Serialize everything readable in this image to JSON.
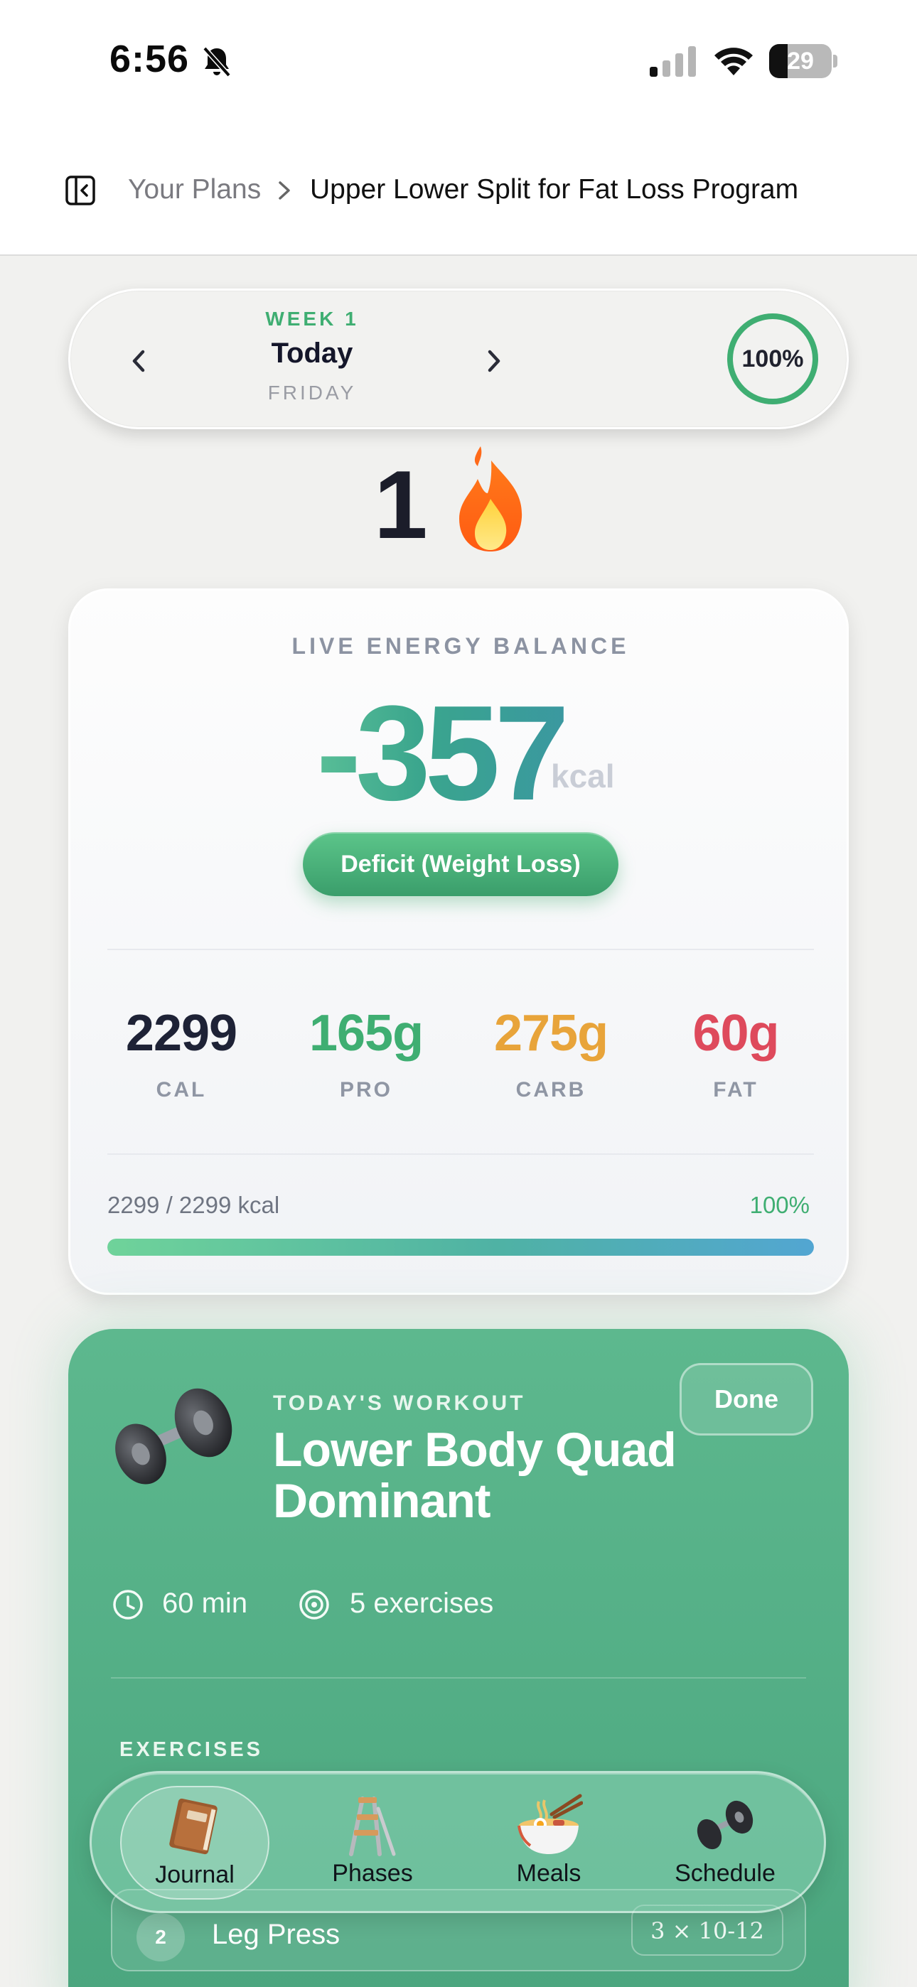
{
  "status_bar": {
    "time": "6:56",
    "battery": "29",
    "battery_level": 0.29
  },
  "header": {
    "breadcrumb_parent": "Your Plans",
    "breadcrumb_current": "Upper Lower Split for Fat Loss Program"
  },
  "week_nav": {
    "week": "WEEK 1",
    "day": "Today",
    "weekday": "FRIDAY",
    "progress_label": "100%",
    "progress_fraction": 1.0,
    "accent_color": "#3fae72"
  },
  "streak": {
    "count": "1",
    "icon": "flame-icon"
  },
  "energy": {
    "title": "LIVE ENERGY BALANCE",
    "value": "-357",
    "unit": "kcal",
    "status": "Deficit (Weight Loss)",
    "macros": [
      {
        "value": "2299",
        "label": "CAL",
        "color": "#1e2236"
      },
      {
        "value": "165g",
        "label": "PRO",
        "color": "#3fae72"
      },
      {
        "value": "275g",
        "label": "CARB",
        "color": "#e8a43a"
      },
      {
        "value": "60g",
        "label": "FAT",
        "color": "#de4a5c"
      }
    ],
    "progress_text": "2299 / 2299 kcal",
    "progress_pct": "100%",
    "progress_fraction": 1.0
  },
  "workout": {
    "eyebrow": "TODAY'S WORKOUT",
    "title": "Lower Body Quad Dominant",
    "done_label": "Done",
    "duration": "60 min",
    "exercise_count": "5 exercises",
    "exercises_heading": "EXERCISES",
    "exercises": [
      {
        "index": "2",
        "name": "Leg Press",
        "sets": "3 × 10-12"
      }
    ]
  },
  "tabbar": {
    "tabs": [
      {
        "label": "Journal",
        "icon": "journal-book-icon",
        "active": true
      },
      {
        "label": "Phases",
        "icon": "step-ladder-icon",
        "active": false
      },
      {
        "label": "Meals",
        "icon": "ramen-bowl-icon",
        "active": false
      },
      {
        "label": "Schedule",
        "icon": "dumbbell-icon",
        "active": false
      }
    ]
  }
}
